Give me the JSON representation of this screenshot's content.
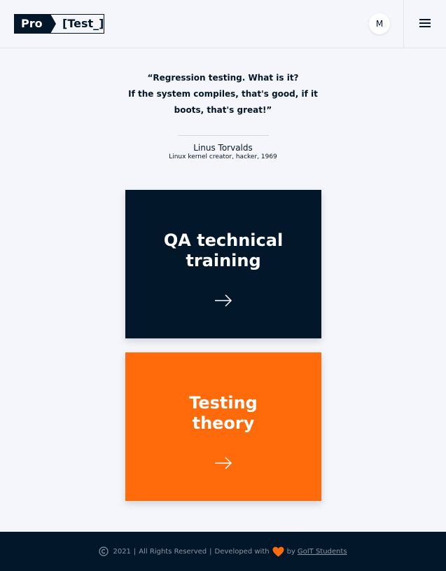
{
  "header": {
    "logo_left": "Pro",
    "logo_right": "[Test_]",
    "avatar_initial": "M"
  },
  "quote": {
    "lines": [
      "“Regression testing. What is it?",
      "If the system compiles, that's good, if it",
      "boots, that's great!”"
    ],
    "author": "Linus Torvalds",
    "author_description": "Linux kernel creator, hacker, 1969"
  },
  "cards": [
    {
      "title_lines": [
        "QA technical",
        "training"
      ],
      "color": "#02172a"
    },
    {
      "title_lines": [
        "Testing",
        "theory"
      ],
      "color": "#ff6b0a"
    }
  ],
  "footer": {
    "year": "2021",
    "rights": "All Rights Reserved",
    "developed": "Developed with",
    "by": "by",
    "link_text": "GoIT Students",
    "heart_color": "#ff6b0a"
  },
  "colors": {
    "dark": "#02172a",
    "accent": "#ff6b0a",
    "background": "#f5f6fb"
  }
}
